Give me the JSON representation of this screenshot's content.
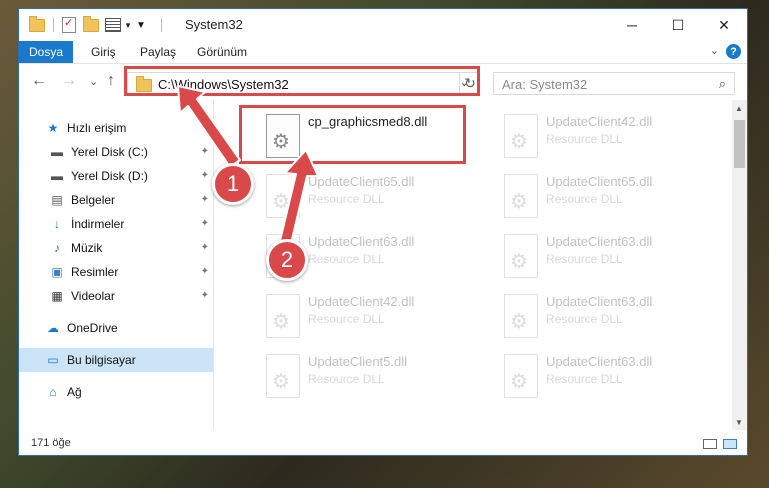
{
  "window": {
    "title": "System32",
    "minimize": "─",
    "maximize": "☐",
    "close": "✕"
  },
  "ribbon": {
    "tabs": [
      "Dosya",
      "Giriş",
      "Paylaş",
      "Görünüm"
    ],
    "toggle": "⌄",
    "help": "?"
  },
  "nav": {
    "back": "←",
    "forward": "→",
    "recent": "⌄",
    "up": "↑",
    "address": "C:\\Windows\\System32",
    "dropdown": "⌄",
    "refresh": "↻",
    "search_placeholder": "Ara: System32",
    "search_icon": "⌕"
  },
  "sidebar": {
    "items": [
      {
        "label": "Hızlı erişim",
        "icon": "star-icon",
        "glyph": "★",
        "color": "#1979ca",
        "pinned": false
      },
      {
        "label": "Yerel Disk (C:)",
        "icon": "drive-icon",
        "glyph": "▬",
        "color": "#555555",
        "pinned": true
      },
      {
        "label": "Yerel Disk (D:)",
        "icon": "drive-icon",
        "glyph": "▬",
        "color": "#555555",
        "pinned": true
      },
      {
        "label": "Belgeler",
        "icon": "documents-icon",
        "glyph": "▤",
        "color": "#555555",
        "pinned": true
      },
      {
        "label": "İndirmeler",
        "icon": "download-icon",
        "glyph": "↓",
        "color": "#1979ca",
        "pinned": true
      },
      {
        "label": "Müzik",
        "icon": "music-icon",
        "glyph": "♪",
        "color": "#1979ca",
        "pinned": true
      },
      {
        "label": "Resimler",
        "icon": "pictures-icon",
        "glyph": "▣",
        "color": "#3b7fc4",
        "pinned": true
      },
      {
        "label": "Videolar",
        "icon": "videos-icon",
        "glyph": "▦",
        "color": "#333333",
        "pinned": true
      },
      {
        "label": "OneDrive",
        "icon": "cloud-icon",
        "glyph": "☁",
        "color": "#1979ca",
        "pinned": false
      },
      {
        "label": "Bu bilgisayar",
        "icon": "computer-icon",
        "glyph": "▭",
        "color": "#1979ca",
        "pinned": false
      },
      {
        "label": "Ağ",
        "icon": "network-icon",
        "glyph": "⌂",
        "color": "#1979ca",
        "pinned": false
      }
    ],
    "pin_glyph": "📌"
  },
  "files": [
    {
      "name": "cp_graphicsmed8.dll",
      "type": "",
      "faded": false
    },
    {
      "name": "UpdateClient42.dll",
      "type": "Resource DLL",
      "faded": true
    },
    {
      "name": "UpdateClient65.dll",
      "type": "Resource DLL",
      "faded": true
    },
    {
      "name": "UpdateClient65.dll",
      "type": "Resource DLL",
      "faded": true
    },
    {
      "name": "UpdateClient63.dll",
      "type": "Resource DLL",
      "faded": true
    },
    {
      "name": "UpdateClient63.dll",
      "type": "Resource DLL",
      "faded": true
    },
    {
      "name": "UpdateClient42.dll",
      "type": "Resource DLL",
      "faded": true
    },
    {
      "name": "UpdateClient63.dll",
      "type": "Resource DLL",
      "faded": true
    },
    {
      "name": "UpdateClient5.dll",
      "type": "Resource DLL",
      "faded": true
    },
    {
      "name": "UpdateClient63.dll",
      "type": "Resource DLL",
      "faded": true
    }
  ],
  "status": {
    "count": "171 öğe"
  },
  "annotations": {
    "step1": "1",
    "step2": "2",
    "color": "#d9494a"
  }
}
